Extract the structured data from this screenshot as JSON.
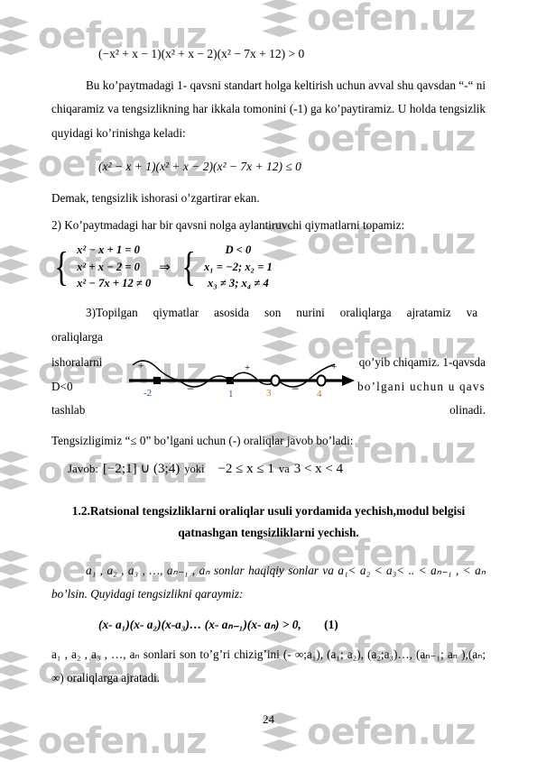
{
  "watermark": {
    "text": "oefen.uz",
    "logo_icon": "stacked-layers-icon",
    "color": "#c9cbcb"
  },
  "document": {
    "page_number": "24",
    "language": "uz"
  },
  "content": {
    "eq_top": "(−x² + x − 1)(x² + x − 2)(x² − 7x + 12) > 0",
    "para1": "Bu ko’paytmadagi 1- qavsni standart holga keltirish uchun avval shu qavsdan “-“ ni chiqaramiz va tengsizlikning har ikkala tomonini (-1) ga ko’paytiramiz. U holda tengsizlik quyidagi ko’rinishga keladi:",
    "eq_second": "(x² − x + 1)(x² + x − 2)(x² − 7x + 12) ≤ 0",
    "line_demak": "Demak, tengsizlik ishorasi o’zgartirar ekan.",
    "line_step2": "2) Ko’paytmadagi har bir qavsni nolga aylantiruvchi qiymatlarni topamiz:",
    "system": {
      "left_rows": [
        "x² − x + 1 = 0",
        "x² + x − 2 = 0",
        "x² − 7x + 12 ≠ 0"
      ],
      "implies": "⇒",
      "right_rows": [
        "D < 0",
        "x₁ = −2;  x₂ = 1",
        "x₃ ≠ 3;  x₄ ≠ 4"
      ]
    },
    "para_step3": "3)Topilgan qiymatlar asosida son nurini oraliqlarga ajratamiz va oraliqlarga ishoralarni qo’yib chiqamiz. 1-qavsda D<0 bo’lgani uchun u qavs tashlab olinadi.",
    "para_step3_words": {
      "w1": "3)Topilgan",
      "w2": "qiymatlar",
      "w3": "asosida",
      "w4": "son",
      "w5": "nurini",
      "w6": "oraliqlarga",
      "w7": "ajratamiz",
      "w8": "va",
      "w9": "oraliqlarga",
      "l2_left": "ishoralarni",
      "l2_right": "qo’yib chiqamiz. 1-qavsda",
      "l3_left": "D<0",
      "l3_right": "bo’lgani uchun u qavs",
      "l4_left": "tashlab",
      "l4_right": "olinadi."
    },
    "line_tengsizligimiz": "Tengsizligimiz  “≤ 0” bo’lgani uchun (-) oraliqlar javob bo’ladi:",
    "answer": {
      "label": "Javob:",
      "interval": "[−2;1] ∪ (3;4)",
      "connector": "yoki",
      "ineq1": "−2 ≤ x ≤ 1",
      "and_word": "va",
      "ineq2": "3 < x < 4"
    },
    "section_title_line1": "1.2.Ratsional tengsizliklarni oraliqlar usuli yordamida yechish,modul belgisi",
    "section_title_line2": "qatnashgan tengsizliklarni yechish.",
    "para_a_sonlar": "a₁ , a₂ , a₃ , …, aₙ₋₁ , aₙ sonlar haqiqiy sonlar va a₁< a₂ < a₃< .. < aₙ₋₁ , < aₙ bo’lsin. Quyidagi tengsizlikni qaraymiz:",
    "bold_equation": "(x- a₁)(x- a₂)(x-a₃)… (x- aₙ₋₁)(x- aₙ) > 0,",
    "equation_number": "(1)",
    "para_last": "a₁ , a₂ , a₃ , …, aₙ sonlari son to’g’ri chizig’ini (- ∞;a₁), (a₁; a₂), (a₂;a₃)…, (aₙ₋₁; aₙ ),(aₙ; ∞) oraliqlarga ajratadi."
  },
  "chart_data": {
    "type": "number-line",
    "title": "Sign chart for (x²−x+1)(x²+x−2)(x²−7x+12) ≤ 0",
    "axis_arrow": "right",
    "points": [
      {
        "label": "-2",
        "marker": "filled",
        "color": "#2d4fa2",
        "x_pct": 20
      },
      {
        "label": "1",
        "marker": "filled",
        "color": "#2d4fa2",
        "x_pct": 47
      },
      {
        "label": "3",
        "marker": "hollow",
        "color": "#c07a22",
        "x_pct": 66
      },
      {
        "label": "4",
        "marker": "hollow",
        "color": "#c07a22",
        "x_pct": 87
      }
    ],
    "intervals": [
      {
        "sign": "+",
        "arc": "above"
      },
      {
        "sign": "−",
        "arc": "below"
      },
      {
        "sign": "+",
        "arc": "above"
      },
      {
        "sign": "−",
        "arc": "below"
      },
      {
        "sign": "+",
        "arc": "above"
      }
    ]
  }
}
